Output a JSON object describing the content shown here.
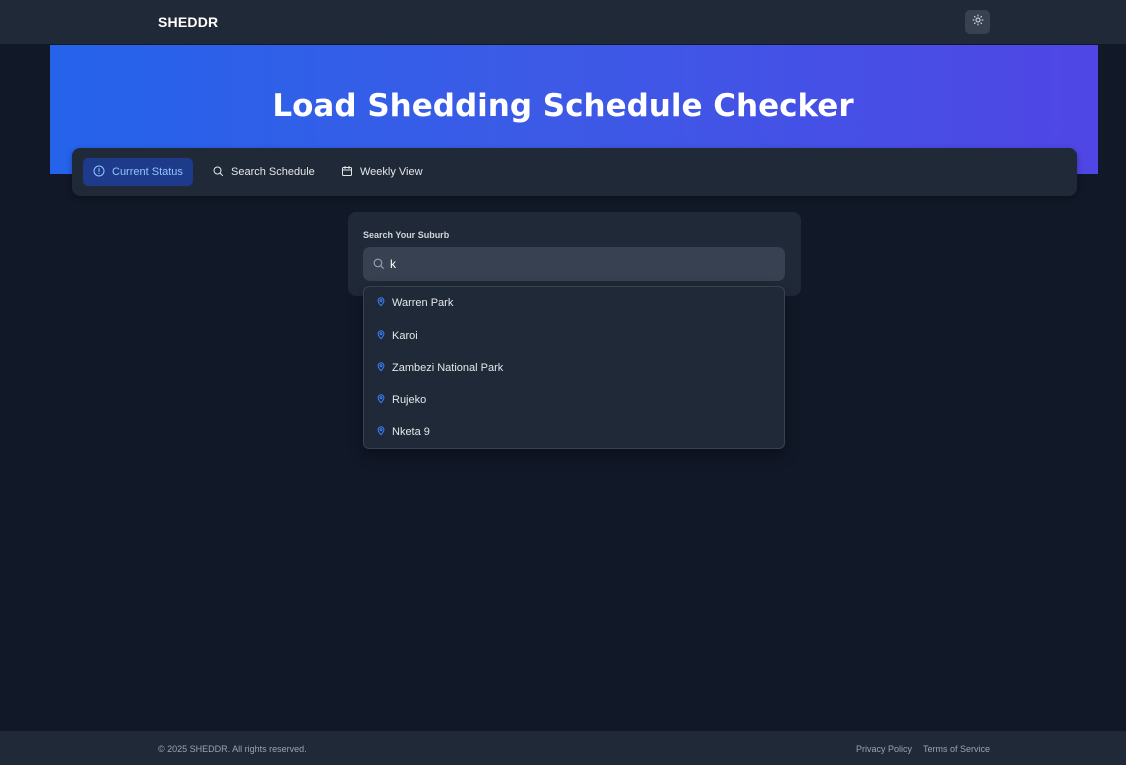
{
  "header": {
    "brand": "SHEDDR",
    "theme_toggle_icon": "sun-icon"
  },
  "hero": {
    "title": "Load Shedding Schedule Checker"
  },
  "tabs": [
    {
      "label": "Current Status",
      "icon": "alert-circle-icon",
      "active": true
    },
    {
      "label": "Search Schedule",
      "icon": "search-icon",
      "active": false
    },
    {
      "label": "Weekly View",
      "icon": "calendar-icon",
      "active": false
    }
  ],
  "search": {
    "label": "Search Your Suburb",
    "value": "k",
    "suggestions": [
      "Warren Park",
      "Karoi",
      "Zambezi National Park",
      "Rujeko",
      "Nketa 9"
    ]
  },
  "footer": {
    "copyright": "© 2025 SHEDDR. All rights reserved.",
    "links": [
      "Privacy Policy",
      "Terms of Service"
    ]
  },
  "colors": {
    "background": "#111827",
    "surface": "#1f2937",
    "accent": "#3b82f6",
    "gradient_start": "#2563eb",
    "gradient_end": "#4f46e5"
  }
}
